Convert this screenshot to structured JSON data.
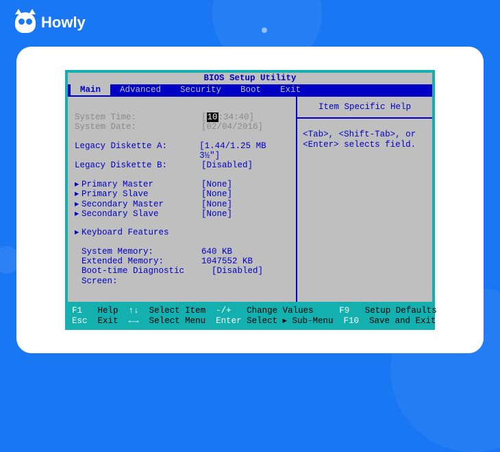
{
  "brand": "Howly",
  "bios": {
    "title": "BIOS Setup Utility",
    "tabs": [
      "Main",
      "Advanced",
      "Security",
      "Boot",
      "Exit"
    ],
    "active_tab": "Main",
    "help": {
      "title": "Item Specific Help",
      "body": "<Tab>, <Shift-Tab>, or <Enter> selects field."
    },
    "rows": {
      "system_time": {
        "label": "System Time:",
        "hh": "10",
        "rest": ":34:40"
      },
      "system_date": {
        "label": "System Date:",
        "value": "[02/04/2016]"
      },
      "diskette_a": {
        "label": "Legacy Diskette A:",
        "value": "[1.44/1.25 MB  3½\"]"
      },
      "diskette_b": {
        "label": "Legacy Diskette B:",
        "value": "[Disabled]"
      },
      "primary_master": {
        "label": "Primary Master",
        "value": "[None]"
      },
      "primary_slave": {
        "label": "Primary Slave",
        "value": "[None]"
      },
      "secondary_master": {
        "label": "Secondary Master",
        "value": "[None]"
      },
      "secondary_slave": {
        "label": "Secondary Slave",
        "value": "[None]"
      },
      "keyboard": {
        "label": "Keyboard Features"
      },
      "sys_mem": {
        "label": "System Memory:",
        "value": "640 KB"
      },
      "ext_mem": {
        "label": "Extended Memory:",
        "value": "1047552 KB"
      },
      "boot_diag": {
        "label": "Boot-time Diagnostic Screen:",
        "value": "[Disabled]"
      }
    },
    "footer": {
      "r1": {
        "k1": "F1",
        "t1": "Help",
        "k2": "↑↓",
        "t2": "Select Item",
        "k3": "-/+",
        "t3": "Change Values",
        "k4": "F9",
        "t4": "Setup Defaults"
      },
      "r2": {
        "k1": "Esc",
        "t1": "Exit",
        "k2": "←→",
        "t2": "Select Menu",
        "k3": "Enter",
        "t3": "Select ▸ Sub-Menu",
        "k4": "F10",
        "t4": "Save and Exit"
      }
    }
  }
}
